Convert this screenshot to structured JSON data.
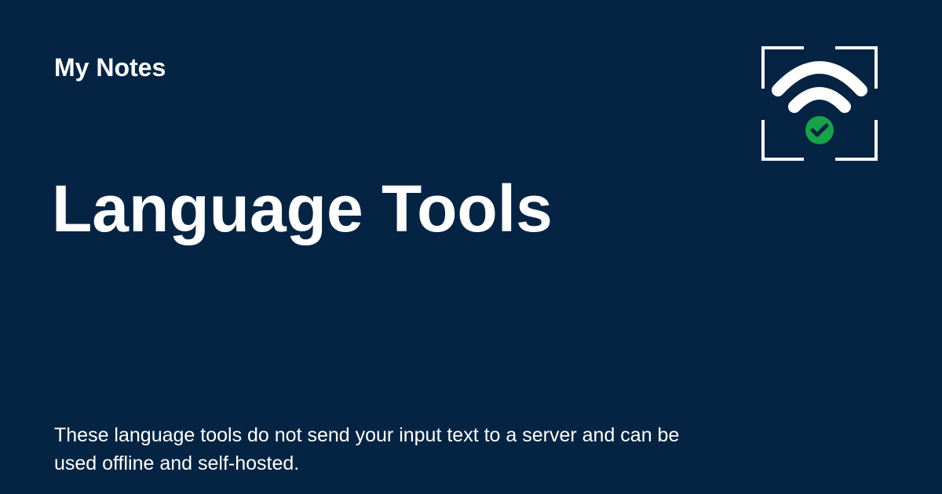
{
  "card": {
    "site_name": "My Notes",
    "title": "Language Tools",
    "description": "These language tools do not send your input text to a server and can be used offline and self-hosted."
  },
  "logo": {
    "icon": "offline-wifi-check-icon",
    "colors": {
      "background": "#052443",
      "foreground": "#ffffff",
      "check": "#16a34a"
    }
  }
}
